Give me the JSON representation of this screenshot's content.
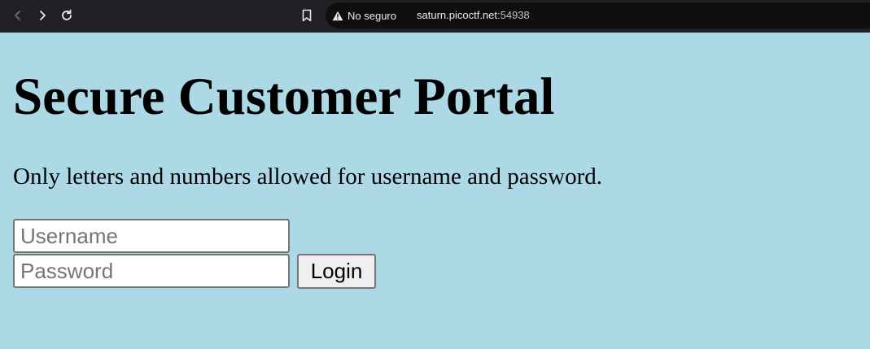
{
  "browser": {
    "security_label": "No seguro",
    "url_host": "saturn.picoctf.net",
    "url_port": ":54938",
    "icons": [
      "back-icon",
      "forward-icon",
      "reload-icon",
      "bookmark-icon",
      "warning-icon"
    ]
  },
  "page": {
    "title": "Secure Customer Portal",
    "instructions": "Only letters and numbers allowed for username and password.",
    "username_placeholder": "Username",
    "password_placeholder": "Password",
    "login_label": "Login",
    "background_color": "#add8e6"
  }
}
